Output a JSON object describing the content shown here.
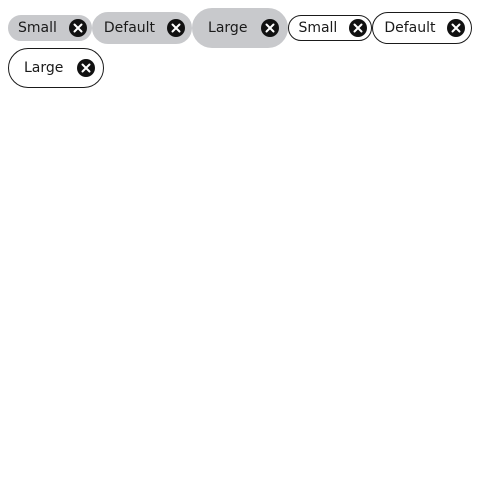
{
  "chips": [
    {
      "label": "Small",
      "variant": "filled",
      "size": "small",
      "icon": "close-circle-icon"
    },
    {
      "label": "Default",
      "variant": "filled",
      "size": "default",
      "icon": "close-circle-icon"
    },
    {
      "label": "Large",
      "variant": "filled",
      "size": "large",
      "icon": "close-circle-icon"
    },
    {
      "label": "Small",
      "variant": "outline",
      "size": "small",
      "icon": "close-circle-icon"
    },
    {
      "label": "Default",
      "variant": "outline",
      "size": "default",
      "icon": "close-circle-icon"
    },
    {
      "label": "Large",
      "variant": "outline",
      "size": "large",
      "icon": "close-circle-icon"
    }
  ],
  "colors": {
    "filled_bg": "#c8c9cc",
    "outline_border": "#1a1a1a",
    "text": "#1a1a1a",
    "icon": "#111111"
  }
}
